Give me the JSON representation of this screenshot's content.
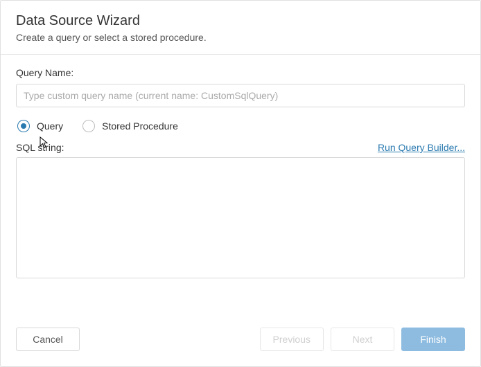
{
  "header": {
    "title": "Data Source Wizard",
    "subtitle": "Create a query or select a stored procedure."
  },
  "form": {
    "queryName": {
      "label": "Query Name:",
      "value": "",
      "placeholder": "Type custom query name (current name: CustomSqlQuery)"
    },
    "queryType": {
      "options": [
        {
          "label": "Query",
          "selected": true
        },
        {
          "label": "Stored Procedure",
          "selected": false
        }
      ]
    },
    "sqlString": {
      "label": "SQL string:",
      "value": "",
      "link": "Run Query Builder..."
    }
  },
  "footer": {
    "cancel": "Cancel",
    "previous": "Previous",
    "next": "Next",
    "finish": "Finish"
  }
}
